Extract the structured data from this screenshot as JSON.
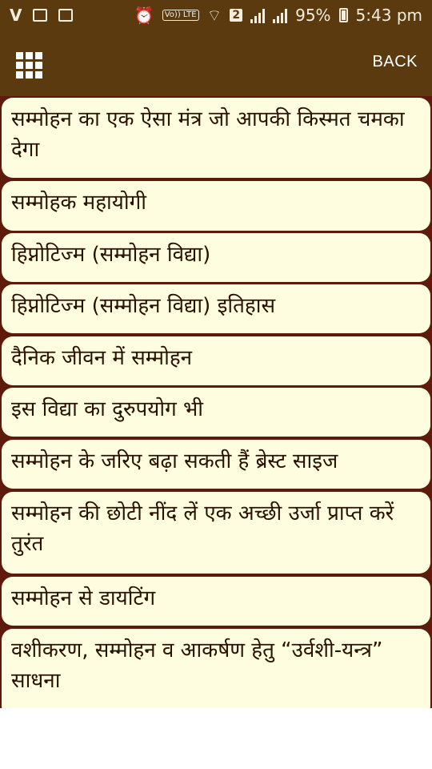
{
  "status_bar": {
    "carrier_icon": "V",
    "volte_label": "Vo)) LTE",
    "sim_label": "2",
    "battery_percent": "95%",
    "time": "5:43 pm"
  },
  "app_bar": {
    "menu_icon": "grid-icon",
    "back_label": "BACK"
  },
  "items": [
    {
      "label": "सम्मोहन का एक ऐसा मंत्र जो आपकी किस्मत चमका देगा"
    },
    {
      "label": "सम्मोहक महायोगी"
    },
    {
      "label": "हिप्नोटिज्म (सम्मोहन विद्या)"
    },
    {
      "label": "हिप्नोटिज्म (सम्मोहन विद्या) इतिहास"
    },
    {
      "label": "दैनिक जीवन में सम्मोहन"
    },
    {
      "label": "इस विद्या का दुरुपयोग भी"
    },
    {
      "label": "सम्मोहन के जरिए बढ़ा सकती हैं ब्रेस्ट साइज"
    },
    {
      "label": "सम्मोहन की छोटी नींद लें एक अच्छी उर्जा प्राप्त करें तुरंत"
    },
    {
      "label": "सम्मोहन से डायटिंग"
    },
    {
      "label": "वशीकरण, सम्मोहन व आकर्षण हेतु “उर्वशी-यन्त्र” साधना"
    }
  ]
}
